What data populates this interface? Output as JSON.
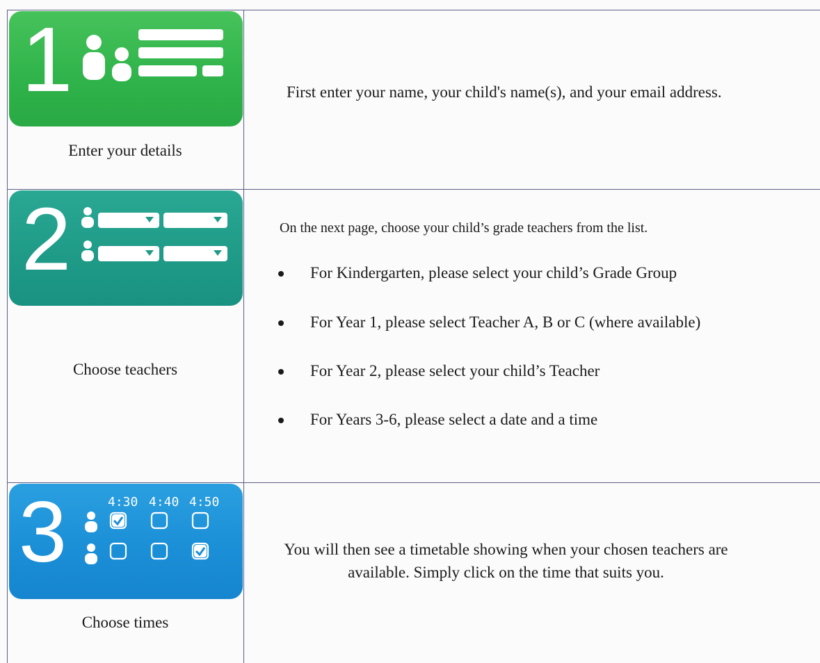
{
  "steps": [
    {
      "number": "1",
      "icon": "details-form-icon",
      "caption": "Enter your details",
      "description": "First enter your name, your child's name(s), and your email address."
    },
    {
      "number": "2",
      "icon": "teacher-dropdowns-icon",
      "caption": "Choose teachers",
      "intro": "On the next page, choose your child’s grade teachers from the list.",
      "bullets": [
        "For Kindergarten, please select your child’s Grade Group",
        "For Year 1, please select Teacher A, B or C (where available)",
        "For Year 2, please select your child’s Teacher",
        "For Years 3-6, please select a date and a time"
      ]
    },
    {
      "number": "3",
      "icon": "timetable-checkbox-icon",
      "caption": "Choose times",
      "times": [
        "4:30",
        "4:40",
        "4:50"
      ],
      "description_line1": "You will then see a timetable showing when your chosen teachers are",
      "description_line2": "available. Simply click on the time that suits you."
    }
  ],
  "colors": {
    "step1": "#2fb34a",
    "step2": "#1e9a87",
    "step3": "#1a8ed6",
    "border": "#5c5f86"
  }
}
